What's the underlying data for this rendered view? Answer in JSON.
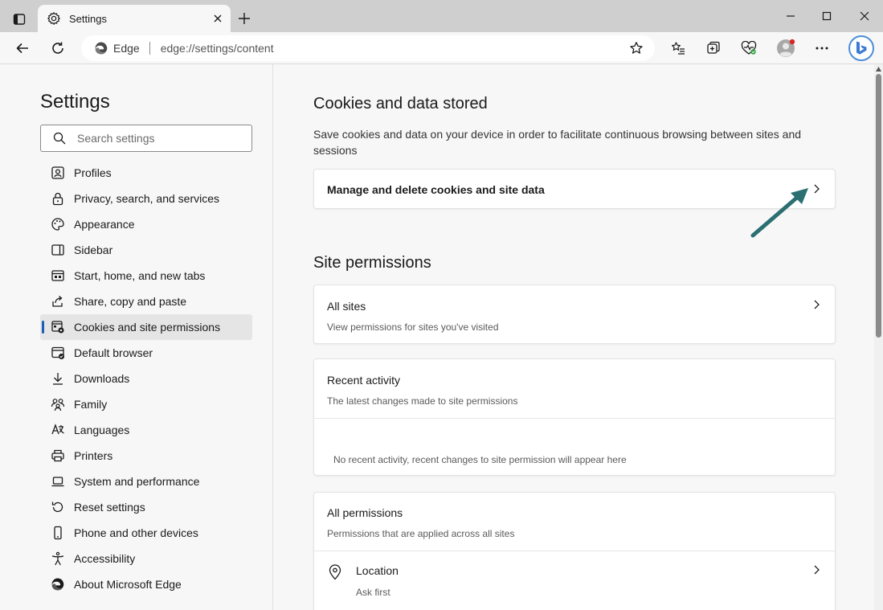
{
  "tab": {
    "title": "Settings",
    "close_icon": "close-icon"
  },
  "window": {
    "minimize_icon": "minimize-icon",
    "maximize_icon": "maximize-icon",
    "close_icon": "close-icon"
  },
  "address": {
    "site_name": "Edge",
    "url_prefix": "edge://",
    "url_path": "settings/content"
  },
  "colors": {
    "accent": "#1a5fb4",
    "annotation_arrow": "#2b6f73",
    "bing": "#4b8dd8"
  },
  "nav": {
    "title": "Settings",
    "search_placeholder": "Search settings",
    "items": [
      {
        "label": "Profiles",
        "icon": "profile-icon"
      },
      {
        "label": "Privacy, search, and services",
        "icon": "lock-icon"
      },
      {
        "label": "Appearance",
        "icon": "palette-icon"
      },
      {
        "label": "Sidebar",
        "icon": "sidebar-icon"
      },
      {
        "label": "Start, home, and new tabs",
        "icon": "home-tabs-icon"
      },
      {
        "label": "Share, copy and paste",
        "icon": "share-icon"
      },
      {
        "label": "Cookies and site permissions",
        "icon": "cookies-icon",
        "active": true
      },
      {
        "label": "Default browser",
        "icon": "browser-icon"
      },
      {
        "label": "Downloads",
        "icon": "download-icon"
      },
      {
        "label": "Family",
        "icon": "family-icon"
      },
      {
        "label": "Languages",
        "icon": "language-icon"
      },
      {
        "label": "Printers",
        "icon": "printer-icon"
      },
      {
        "label": "System and performance",
        "icon": "laptop-icon"
      },
      {
        "label": "Reset settings",
        "icon": "reset-icon"
      },
      {
        "label": "Phone and other devices",
        "icon": "phone-icon"
      },
      {
        "label": "Accessibility",
        "icon": "accessibility-icon"
      },
      {
        "label": "About Microsoft Edge",
        "icon": "edge-logo-icon"
      }
    ]
  },
  "main": {
    "cookies": {
      "title": "Cookies and data stored",
      "description": "Save cookies and data on your device in order to facilitate continuous browsing between sites and sessions",
      "manage_label": "Manage and delete cookies and site data"
    },
    "site_permissions": {
      "title": "Site permissions",
      "all_sites": {
        "title": "All sites",
        "subtitle": "View permissions for sites you've visited"
      },
      "recent_activity": {
        "title": "Recent activity",
        "subtitle": "The latest changes made to site permissions",
        "empty_text": "No recent activity, recent changes to site permission will appear here"
      },
      "all_permissions": {
        "title": "All permissions",
        "subtitle": "Permissions that are applied across all sites"
      },
      "location": {
        "title": "Location",
        "subtitle": "Ask first"
      }
    }
  }
}
